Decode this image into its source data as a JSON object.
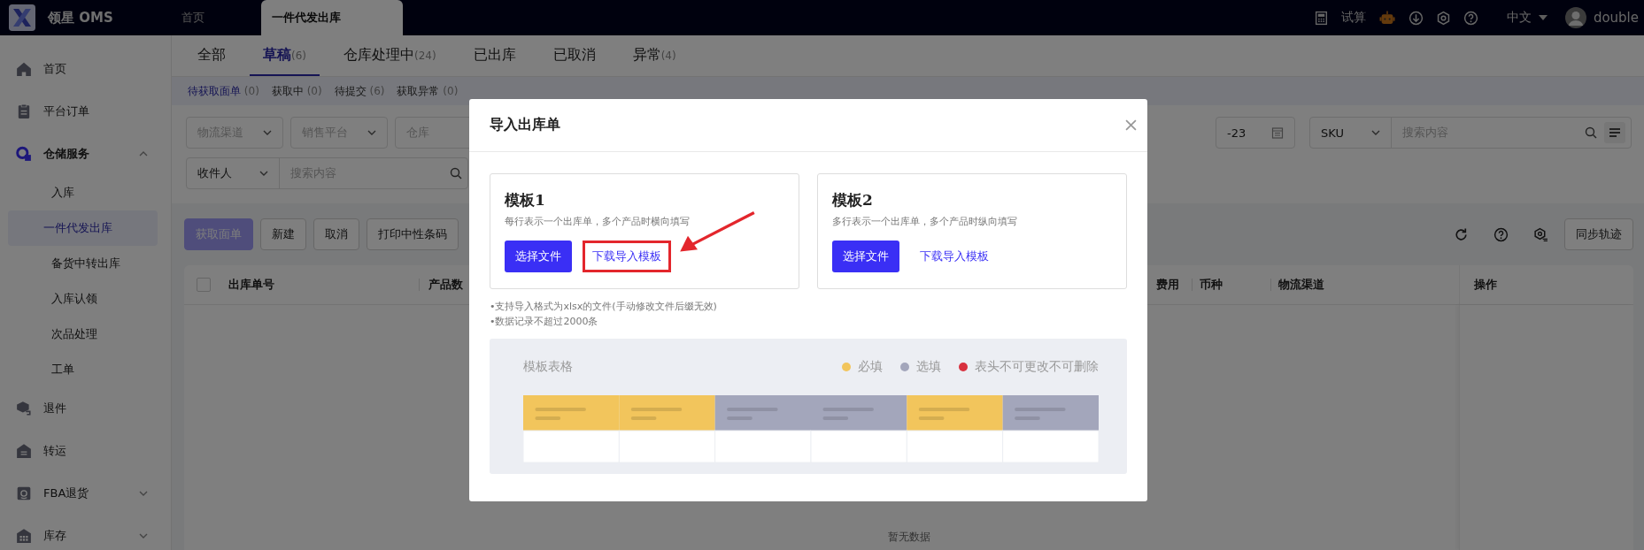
{
  "topbar": {
    "logo": "领星 OMS",
    "tabs": [
      {
        "label": "首页",
        "selected": false
      },
      {
        "label": "一件代发出库",
        "selected": true
      }
    ],
    "calculator": "试算",
    "language": "中文",
    "user": "double"
  },
  "sidebar": {
    "items": [
      {
        "label": "首页"
      },
      {
        "label": "平台订单"
      },
      {
        "label": "仓储服务",
        "expanded": true,
        "children": [
          {
            "label": "入库",
            "selected": false
          },
          {
            "label": "一件代发出库",
            "selected": true
          },
          {
            "label": "备货中转出库",
            "selected": false
          },
          {
            "label": "入库认领",
            "selected": false
          },
          {
            "label": "次品处理",
            "selected": false
          },
          {
            "label": "工单",
            "selected": false
          }
        ]
      },
      {
        "label": "退件"
      },
      {
        "label": "转运"
      },
      {
        "label": "FBA退货",
        "expanded": false
      },
      {
        "label": "库存",
        "expanded": false
      }
    ]
  },
  "status_tabs": [
    {
      "label": "全部",
      "selected": false
    },
    {
      "label": "草稿",
      "count": "(6)",
      "selected": true
    },
    {
      "label": "仓库处理中",
      "count": "(24)",
      "selected": false
    },
    {
      "label": "已出库",
      "selected": false
    },
    {
      "label": "已取消",
      "selected": false
    },
    {
      "label": "异常",
      "count": "(4)",
      "selected": false
    }
  ],
  "sub_tabs": [
    {
      "label": "待获取面单",
      "count": "(0)",
      "selected": true
    },
    {
      "label": "获取中",
      "count": "(0)",
      "selected": false
    },
    {
      "label": "待提交",
      "count": "(6)",
      "selected": false
    },
    {
      "label": "获取异常",
      "count": "(0)",
      "selected": false
    }
  ],
  "filters": {
    "logistics": {
      "placeholder": "物流渠道"
    },
    "platform": {
      "placeholder": "销售平台"
    },
    "warehouse": {
      "placeholder": "仓库"
    },
    "date": {
      "value": "-23"
    },
    "sku": {
      "type": "SKU",
      "placeholder": "搜索内容"
    },
    "recipient": {
      "type": "收件人",
      "placeholder": "搜索内容"
    }
  },
  "actions": [
    {
      "label": "获取面单",
      "disabled": true
    },
    {
      "label": "新建",
      "disabled": false
    },
    {
      "label": "取消",
      "disabled": false
    },
    {
      "label": "打印中性条码",
      "disabled": false
    }
  ],
  "sync_button": "同步轨迹",
  "table": {
    "select_all_checked": false,
    "columns_left": [
      "出库单号",
      "产品数"
    ],
    "columns_right": [
      "费用",
      "币种",
      "物流渠道"
    ],
    "action_column": "操作",
    "empty": "暂无数据"
  },
  "modal": {
    "title": "导入出库单",
    "templates": [
      {
        "title": "模板1",
        "description": "每行表示一个出库单，多个产品时横向填写",
        "choose_button": "选择文件",
        "download_link": "下载导入模板",
        "highlighted": true
      },
      {
        "title": "模板2",
        "description": "多行表示一个出库单，多个产品时纵向填写",
        "choose_button": "选择文件",
        "download_link": "下载导入模板",
        "highlighted": false
      }
    ],
    "notes": [
      "•支持导入格式为xlsx的文件(手动修改文件后缀无效)",
      "•数据记录不超过2000条"
    ],
    "preview": {
      "title": "模板表格",
      "legend": [
        {
          "label": "必填",
          "color": "#f2c55c"
        },
        {
          "label": "选填",
          "color": "#a3a6bb"
        },
        {
          "label": "表头不可更改不可删除",
          "color": "#d8313f"
        }
      ]
    }
  }
}
